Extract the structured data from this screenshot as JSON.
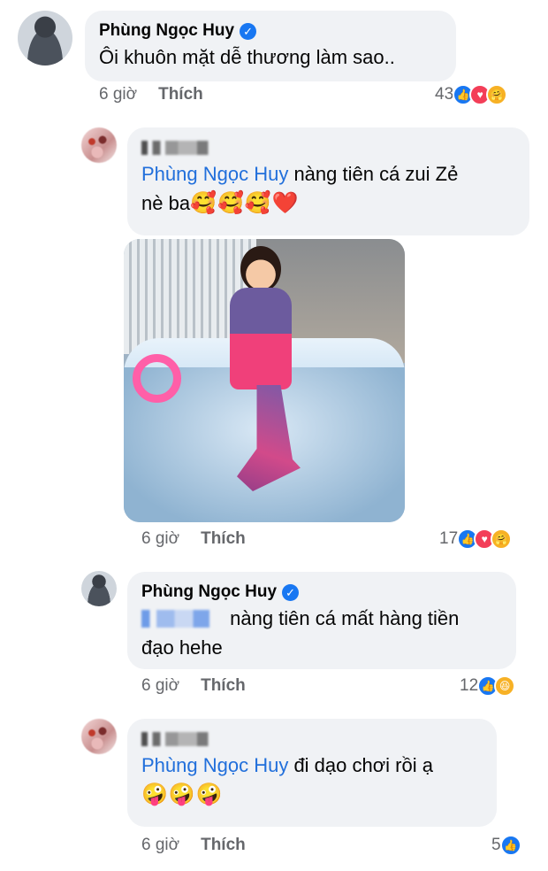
{
  "comments": [
    {
      "author": "Phùng Ngọc Huy",
      "verified": true,
      "text": "Ôi khuôn mặt dễ thương làm sao..",
      "time": "6 giờ",
      "like_label": "Thích",
      "reaction_count": "43",
      "reactions": [
        "like",
        "love",
        "care"
      ]
    },
    {
      "author": "(blurred name)",
      "mention": "Phùng Ngọc Huy",
      "text_line1": " nàng tiên cá zui Zẻ",
      "text_line2": "nè ba",
      "emojis": "🥰🥰🥰❤️",
      "time": "6 giờ",
      "like_label": "Thích",
      "reaction_count": "17",
      "reactions": [
        "like",
        "love",
        "care"
      ]
    },
    {
      "author": "Phùng Ngọc Huy",
      "verified": true,
      "text_line1": " nàng tiên cá mất hàng tiền",
      "text_line2": "đạo hehe",
      "time": "6 giờ",
      "like_label": "Thích",
      "reaction_count": "12",
      "reactions": [
        "like",
        "haha"
      ]
    },
    {
      "author": "(blurred name)",
      "mention": "Phùng Ngọc Huy",
      "text_line1": " đi dạo chơi rồi ạ",
      "emojis": "🤪🤪🤪",
      "time": "6 giờ",
      "like_label": "Thích",
      "reaction_count": "5",
      "reactions": [
        "like"
      ]
    }
  ],
  "colors": {
    "bubble": "#f0f2f5",
    "mention": "#216fdb",
    "meta": "#65676b",
    "like_reaction": "#1877f2",
    "love_reaction": "#f33e58"
  }
}
